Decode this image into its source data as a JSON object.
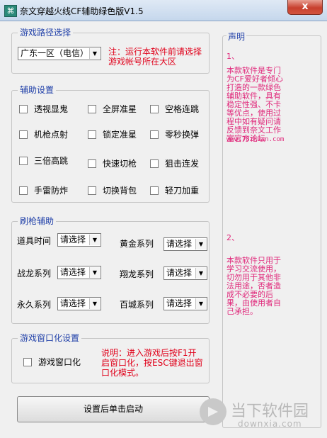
{
  "window": {
    "title": "奈文穿越火线CF辅助绿色版V1.5",
    "icon_glyph": "⌘",
    "close_label": "x"
  },
  "path_group": {
    "title": "游戏路径选择",
    "region_selected": "广东一区（电信）",
    "note": "注：运行本软件前请选择游戏帐号所在大区"
  },
  "assist_group": {
    "title": "辅助设置",
    "options": [
      "透视显鬼",
      "全屏准星",
      "空格连跳",
      "机枪点射",
      "锁定准星",
      "零秒换弹",
      "三倍高跳",
      "快速切枪",
      "狙击连发",
      "手雷防炸",
      "切换背包",
      "轻刀加重"
    ]
  },
  "brush_group": {
    "title": "刷枪辅助",
    "rows": [
      {
        "label": "道具时间",
        "value": "请选择"
      },
      {
        "label": "黄金系列",
        "value": "请选择"
      },
      {
        "label": "战龙系列",
        "value": "请选择"
      },
      {
        "label": "翔龙系列",
        "value": "请选择"
      },
      {
        "label": "永久系列",
        "value": "请选择"
      },
      {
        "label": "百城系列",
        "value": "请选择"
      }
    ]
  },
  "window_group": {
    "title": "游戏窗口化设置",
    "checkbox_label": "游戏窗口化",
    "note": "说明：进入游戏后按F1开启窗口化，按ESC键退出窗口化模式。"
  },
  "statement": {
    "title": "声明",
    "p1_index": "1、",
    "p1_text": "本款软件是专门为CF爱好者倾心打造的一款绿色辅助软件，具有稳定性强、不卡等优点，使用过程中如有疑问请反馈到奈文工作室官方论坛",
    "p1_url": "www.78zhuan.com",
    "p2_index": "2、",
    "p2_text": "本款软件只用于学习交流使用，切勿用于其他非法用途，否者造成不必要的后果，由使用者自己承担。"
  },
  "start_button": "设置后单击启动",
  "watermark": {
    "name": "当下软件园",
    "url": "downxia.com"
  },
  "colors": {
    "group_title": "#1f3fa8",
    "note_red": "#e0001a",
    "statement_pink": "#e0277a"
  }
}
